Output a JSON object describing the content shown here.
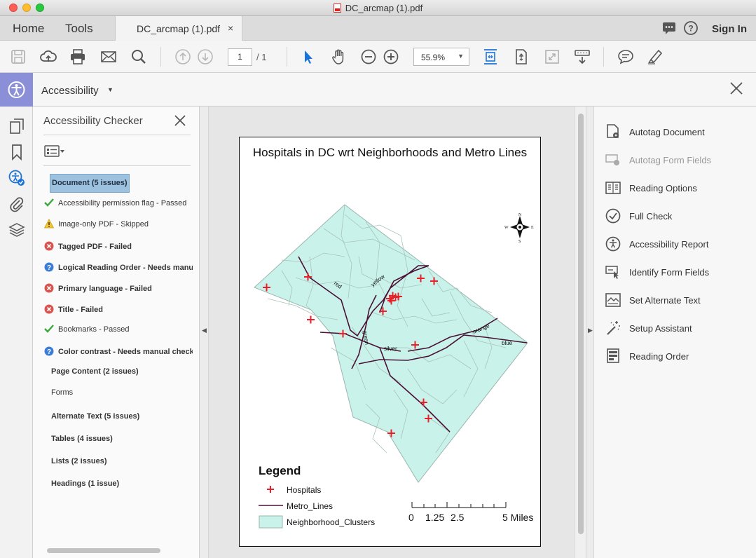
{
  "window": {
    "title": "DC_arcmap (1).pdf"
  },
  "tabs": {
    "home": "Home",
    "tools": "Tools",
    "document": "DC_arcmap (1).pdf",
    "close": "×",
    "sign_in": "Sign In"
  },
  "toolbar": {
    "page_current": "1",
    "page_total": "/ 1",
    "zoom": "55.9%"
  },
  "accessibility_bar": {
    "title": "Accessibility"
  },
  "checker": {
    "title": "Accessibility Checker",
    "document_item": "Document (5 issues)",
    "items": [
      {
        "status": "passed",
        "label": "Accessibility permission flag - Passed",
        "bold": false
      },
      {
        "status": "skipped",
        "label": "Image-only PDF - Skipped",
        "bold": false
      },
      {
        "status": "failed",
        "label": "Tagged PDF - Failed",
        "bold": true
      },
      {
        "status": "manual",
        "label": "Logical Reading Order - Needs manual check",
        "bold": true
      },
      {
        "status": "failed",
        "label": "Primary language - Failed",
        "bold": true
      },
      {
        "status": "failed",
        "label": "Title - Failed",
        "bold": true
      },
      {
        "status": "passed",
        "label": "Bookmarks - Passed",
        "bold": false
      },
      {
        "status": "manual",
        "label": "Color contrast - Needs manual check",
        "bold": true
      }
    ],
    "categories": [
      {
        "label": "Page Content (2 issues)",
        "bold": true
      },
      {
        "label": "Forms",
        "bold": false
      },
      {
        "label": "Alternate Text (5 issues)",
        "bold": true
      },
      {
        "label": "Tables (4 issues)",
        "bold": true
      },
      {
        "label": "Lists (2 issues)",
        "bold": true
      },
      {
        "label": "Headings (1 issue)",
        "bold": true
      }
    ]
  },
  "map": {
    "title": "Hospitals in DC wrt Neighborhoods and Metro Lines",
    "compass": {
      "n": "N",
      "s": "S",
      "e": "E",
      "w": "W"
    },
    "line_labels": {
      "red": "red",
      "yellow": "yellow",
      "green": "green",
      "silver": "silver",
      "orange": "orange",
      "blue": "blue"
    },
    "legend": {
      "title": "Legend",
      "hospitals": "Hospitals",
      "metro_lines": "Metro_Lines",
      "neighborhoods": "Neighborhood_Clusters"
    },
    "scale_bar": {
      "t0": "0",
      "t1": "1.25",
      "t2": "2.5",
      "t3": "5 Miles"
    },
    "colors": {
      "land": "#c9f3ea",
      "hospital": "#e8202a",
      "metro": "#4a1036",
      "boundary": "#9ab5ae"
    }
  },
  "tools": [
    {
      "label": "Autotag Document",
      "enabled": true,
      "icon": "autotag-icon"
    },
    {
      "label": "Autotag Form Fields",
      "enabled": false,
      "icon": "form-fields-icon"
    },
    {
      "label": "Reading Options",
      "enabled": true,
      "icon": "reading-options-icon"
    },
    {
      "label": "Full Check",
      "enabled": true,
      "icon": "full-check-icon"
    },
    {
      "label": "Accessibility Report",
      "enabled": true,
      "icon": "report-icon"
    },
    {
      "label": "Identify Form Fields",
      "enabled": true,
      "icon": "identify-fields-icon"
    },
    {
      "label": "Set Alternate Text",
      "enabled": true,
      "icon": "alt-text-icon"
    },
    {
      "label": "Setup Assistant",
      "enabled": true,
      "icon": "wand-icon"
    },
    {
      "label": "Reading Order",
      "enabled": true,
      "icon": "reading-order-icon"
    }
  ]
}
